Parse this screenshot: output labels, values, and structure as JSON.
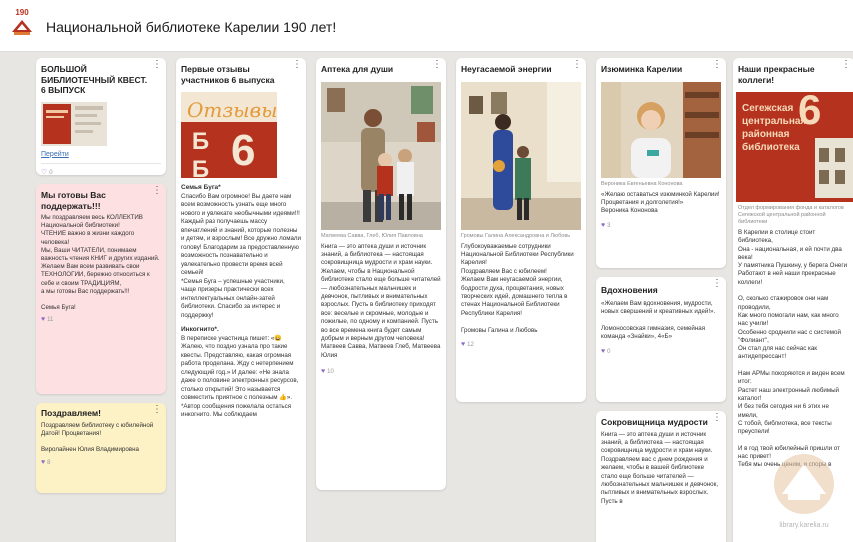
{
  "board": {
    "logo_number": "190",
    "title": "Национальной библиотеке Карелии 190 лет!"
  },
  "colors": {
    "accent_red": "#b5321f",
    "like_purple": "#8e6cc7",
    "pink_card": "#fde0e2",
    "yellow_card": "#fdf1c6"
  },
  "col1": {
    "card1": {
      "title": "БОЛЬШОЙ БИБЛИОТЕЧНЫЙ КВЕСТ. 6 ВЫПУСК",
      "link": "Перейти",
      "likes": "0"
    },
    "card2": {
      "title": "Мы готовы Вас поддержать!!!",
      "text": "Мы поздравляем весь КОЛЛЕКТИВ Национальной библиотеки!\nЧТЕНИЕ важно в жизни каждого человека!\nМы, Ваши ЧИТАТЕЛИ, понимаем важность чтения КНИГ и других изданий.\nЖелаем Вам всем развивать свои ТЕХНОЛОГИИ, бережно относиться к себе и своим ТРАДИЦИЯМ,\nа мы готовы Вас поддержать!!!\n\nСемья Буга!",
      "likes": "11"
    },
    "card3": {
      "title": "Поздравляем!",
      "text": "Поздравляем библиотеку с юбилейной Датой! Процветания!\n\nВиролайнен Юлия Владимировна",
      "likes": "8"
    }
  },
  "col2": {
    "card1": {
      "title": "Первые отзывы участников 6 выпуска",
      "image_word": "Отзывы",
      "image_letters": "ББК",
      "image_number": "6",
      "text_heading": "Семья Буга*",
      "text": "Спасибо Вам огромное! Вы даете нам всем возможность узнать еще много нового и увлекате необычными идеями!!! Каждый раз получаешь массу впечатлений и знаний, которые полезны и детям, и взрослым! Все дружно ломали голову! Благодарим за предоставленную возможность познавательно и увлекательно провести время всей семьей!\n*Семья Буга – успешные участники, чаще призеры практически всех интеллектуальных онлайн-затей библиотеки. Спасибо за интерес и поддержку!",
      "text2_heading": "Инкогнито*.",
      "text2": "В переписке участница пишет: «😀 Жалею, что поздно узнала про такие квесты. Представляю, какая огромная работа проделана. Жду с нетерпением следующий год.» И далее: «Не знала даже о половине электронных ресурсов, столько открытий! Это называется совместить приятное с полезным 👍». *Автор сообщения пожелала остаться инкогнито. Мы соблюдаем"
    }
  },
  "col3": {
    "card1": {
      "title": "Аптека для души",
      "caption": "Матвеева Савва, Глеб, Юлия Павловна",
      "text": "Книга — это аптека души и источник знаний, а библиотека — настоящая сокровищница мудрости и храм науки. Желаем, чтобы в Национальной библиотеке стало еще больше читателей — любознательных мальчишек и девчонок, пытливых и внимательных взрослых. Пусть в библиотеку приходят все: веселые и скромные, молодые и пожилые, по одному и компанией. Пусть во все времена книга будет самым добрым и верным другом человека!\nМатвеев Савва, Матвеев Глеб, Матвеева Юлия",
      "likes": "10"
    }
  },
  "col4": {
    "card1": {
      "title": "Неугасаемой энергии",
      "caption": "Громовы Галина Александровна и Любовь",
      "text": "Глубокоуважаемые сотрудники Национальной Библиотеки Республики Карелия!\nПоздравляем Вас с юбилеем!\nЖелаем Вам неугасаемой энергии, бодрости духа, процветания, новых творческих идей, домашнего тепла в стенах Национальной Библиотеки Республики Карелия!\n\nГромовы Галина и Любовь",
      "likes": "12"
    }
  },
  "col5": {
    "card1": {
      "title": "Изюминка Карелии",
      "caption": "Вероника Евгеньевна Кононова",
      "text": "«Желаю оставаться изюминкой Карелии! Процветания и долголетия!»\nВероника Кононова",
      "likes": "3"
    },
    "card2": {
      "title": "Вдохновения",
      "text": "«Желаем Вам вдохновения, мудрости, новых свершений и креативных идей!».\n\nЛомоносовская гимназия, семейная команда «Знайки», 4«Б»",
      "likes": "0"
    },
    "card3": {
      "title": "Сокровищница мудрости",
      "text": "Книга — это аптека души и источник знаний, а библиотека — настоящая сокровищница мудрости и храм науки. Поздравляем вас с днем рождения и желаем, чтобы в вашей библиотеке стало еще больше читателей — любознательных мальчишек и девчонок, пытливых и внимательных взрослых. Пусть в"
    }
  },
  "col6": {
    "card1": {
      "title": "Наши прекрасные коллеги!",
      "image_text": "Сегежская центральная районная библиотека",
      "image_number": "6",
      "caption": "Отдел формирования фонда и каталогов Сегежской центральной районной библиотеки",
      "text": "В Карелии в столице стоит библиотека,\nОна - национальная, и ей почти два века!\nУ памятника Пушкину, у берега Онеги\nРаботают в ней наши прекрасные коллеги!\n\nО, сколько стажировок они нам проводили,\nКак много помогали нам, как много нас учили!\nОсобенно сроднили нас с системой \"Фолиант\",\nОн стал для нас сейчас как антидепрессант!\n\nНам АРМы покоряются и виден всем итог:\nРастет наш электронный любимый каталог!\nИ без тебя сегодня ни 6 этих не имели,\nС тобой, библиотека, все тексты преуспели!\n\nИ в год твой юбилейный пришли от нас привет!\nТебя мы очень ценим, и споры в"
    }
  },
  "watermark_text": "library.karelia.ru"
}
